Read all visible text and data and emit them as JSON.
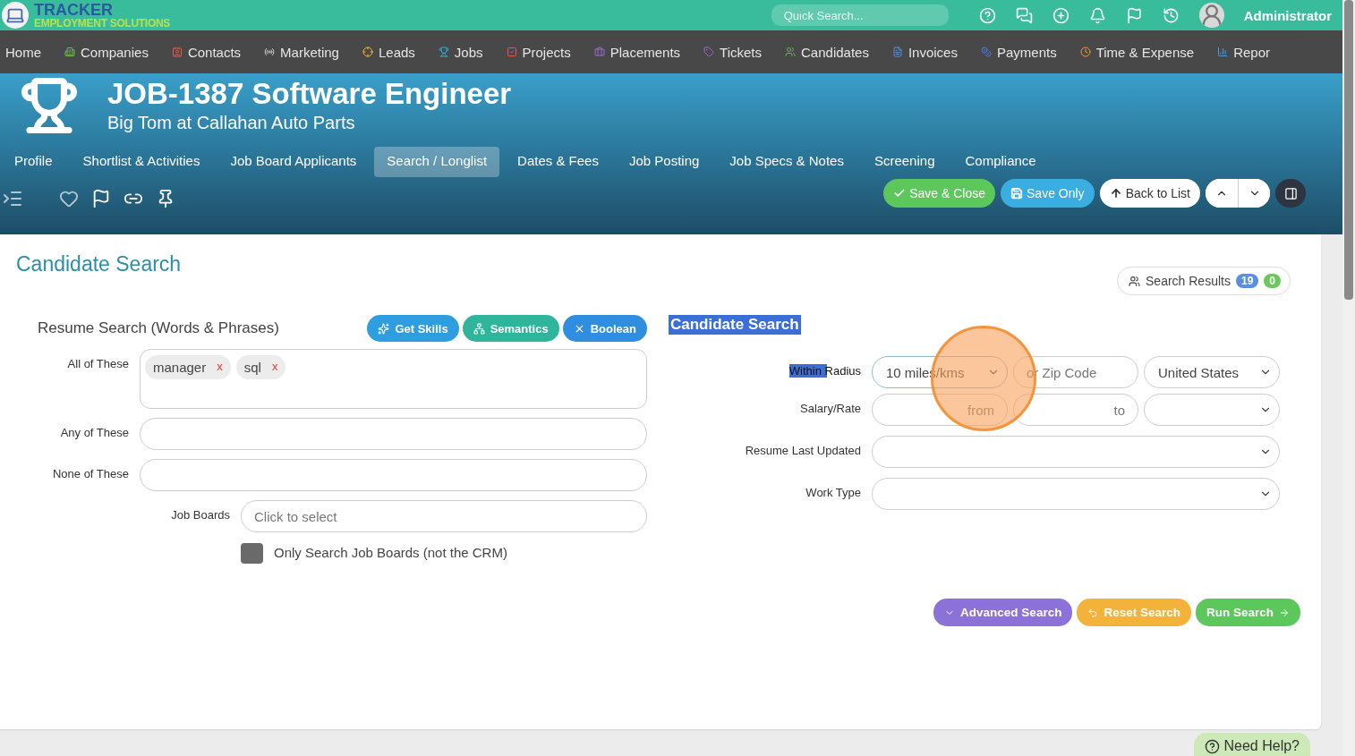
{
  "brand": {
    "name": "TRACKER",
    "tagline": "EMPLOYMENT SOLUTIONS"
  },
  "quick_search": {
    "placeholder": "Quick Search..."
  },
  "user": {
    "name": "Administrator"
  },
  "nav": [
    {
      "label": "Home"
    },
    {
      "label": "Companies"
    },
    {
      "label": "Contacts"
    },
    {
      "label": "Marketing"
    },
    {
      "label": "Leads"
    },
    {
      "label": "Jobs"
    },
    {
      "label": "Projects"
    },
    {
      "label": "Placements"
    },
    {
      "label": "Tickets"
    },
    {
      "label": "Candidates"
    },
    {
      "label": "Invoices"
    },
    {
      "label": "Payments"
    },
    {
      "label": "Time & Expense"
    },
    {
      "label": "Repor"
    }
  ],
  "record": {
    "title": "JOB-1387 Software Engineer",
    "subtitle": "Big Tom at Callahan Auto Parts"
  },
  "tabs": [
    {
      "label": "Profile",
      "selected": false
    },
    {
      "label": "Shortlist & Activities",
      "selected": false
    },
    {
      "label": "Job Board Applicants",
      "selected": false
    },
    {
      "label": "Search / Longlist",
      "selected": true
    },
    {
      "label": "Dates & Fees",
      "selected": false
    },
    {
      "label": "Job Posting",
      "selected": false
    },
    {
      "label": "Job Specs & Notes",
      "selected": false
    },
    {
      "label": "Screening",
      "selected": false
    },
    {
      "label": "Compliance",
      "selected": false
    }
  ],
  "actions": [
    {
      "label": "Save & Close",
      "kind": "save"
    },
    {
      "label": "Save Only",
      "kind": "save-only"
    },
    {
      "label": "Back to List",
      "kind": "back"
    }
  ],
  "page_title": "Candidate Search",
  "search_results": {
    "label": "Search Results",
    "counts": [
      "19",
      "0"
    ]
  },
  "resume_search": {
    "title": "Resume Search (Words & Phrases)",
    "buttons": [
      {
        "label": "Get Skills",
        "kind": "skills"
      },
      {
        "label": "Semantics",
        "kind": "semantics"
      },
      {
        "label": "Boolean",
        "kind": "boolean"
      }
    ],
    "all_label": "All of These",
    "tags": [
      {
        "text": "manager",
        "remove": "x"
      },
      {
        "text": "sql",
        "remove": "x"
      }
    ],
    "any_label": "Any of These",
    "none_label": "None of These",
    "job_boards": {
      "label": "Job Boards",
      "placeholder": "Click to select"
    },
    "job_boards_only": {
      "label": "Only Search Job Boards (not the CRM)",
      "checked": false
    }
  },
  "criteria": {
    "title": "Candidate Search",
    "title_highlighted": true,
    "radius": {
      "label": "Within Radius",
      "label_highlighted": true,
      "value": "10 miles/kms",
      "zip_placeholder": "or Zip Code",
      "country": "United States"
    },
    "salary": {
      "label": "Salary/Rate",
      "from_placeholder": "from",
      "to_placeholder": "to"
    },
    "updated_label": "Resume Last Updated",
    "work_type_label": "Work Type"
  },
  "footer_buttons": [
    {
      "label": "Advanced Search",
      "kind": "advanced"
    },
    {
      "label": "Reset Search",
      "kind": "reset"
    },
    {
      "label": "Run Search",
      "kind": "run"
    }
  ],
  "click_indicator": {
    "shown": true
  },
  "help": "Need Help?"
}
